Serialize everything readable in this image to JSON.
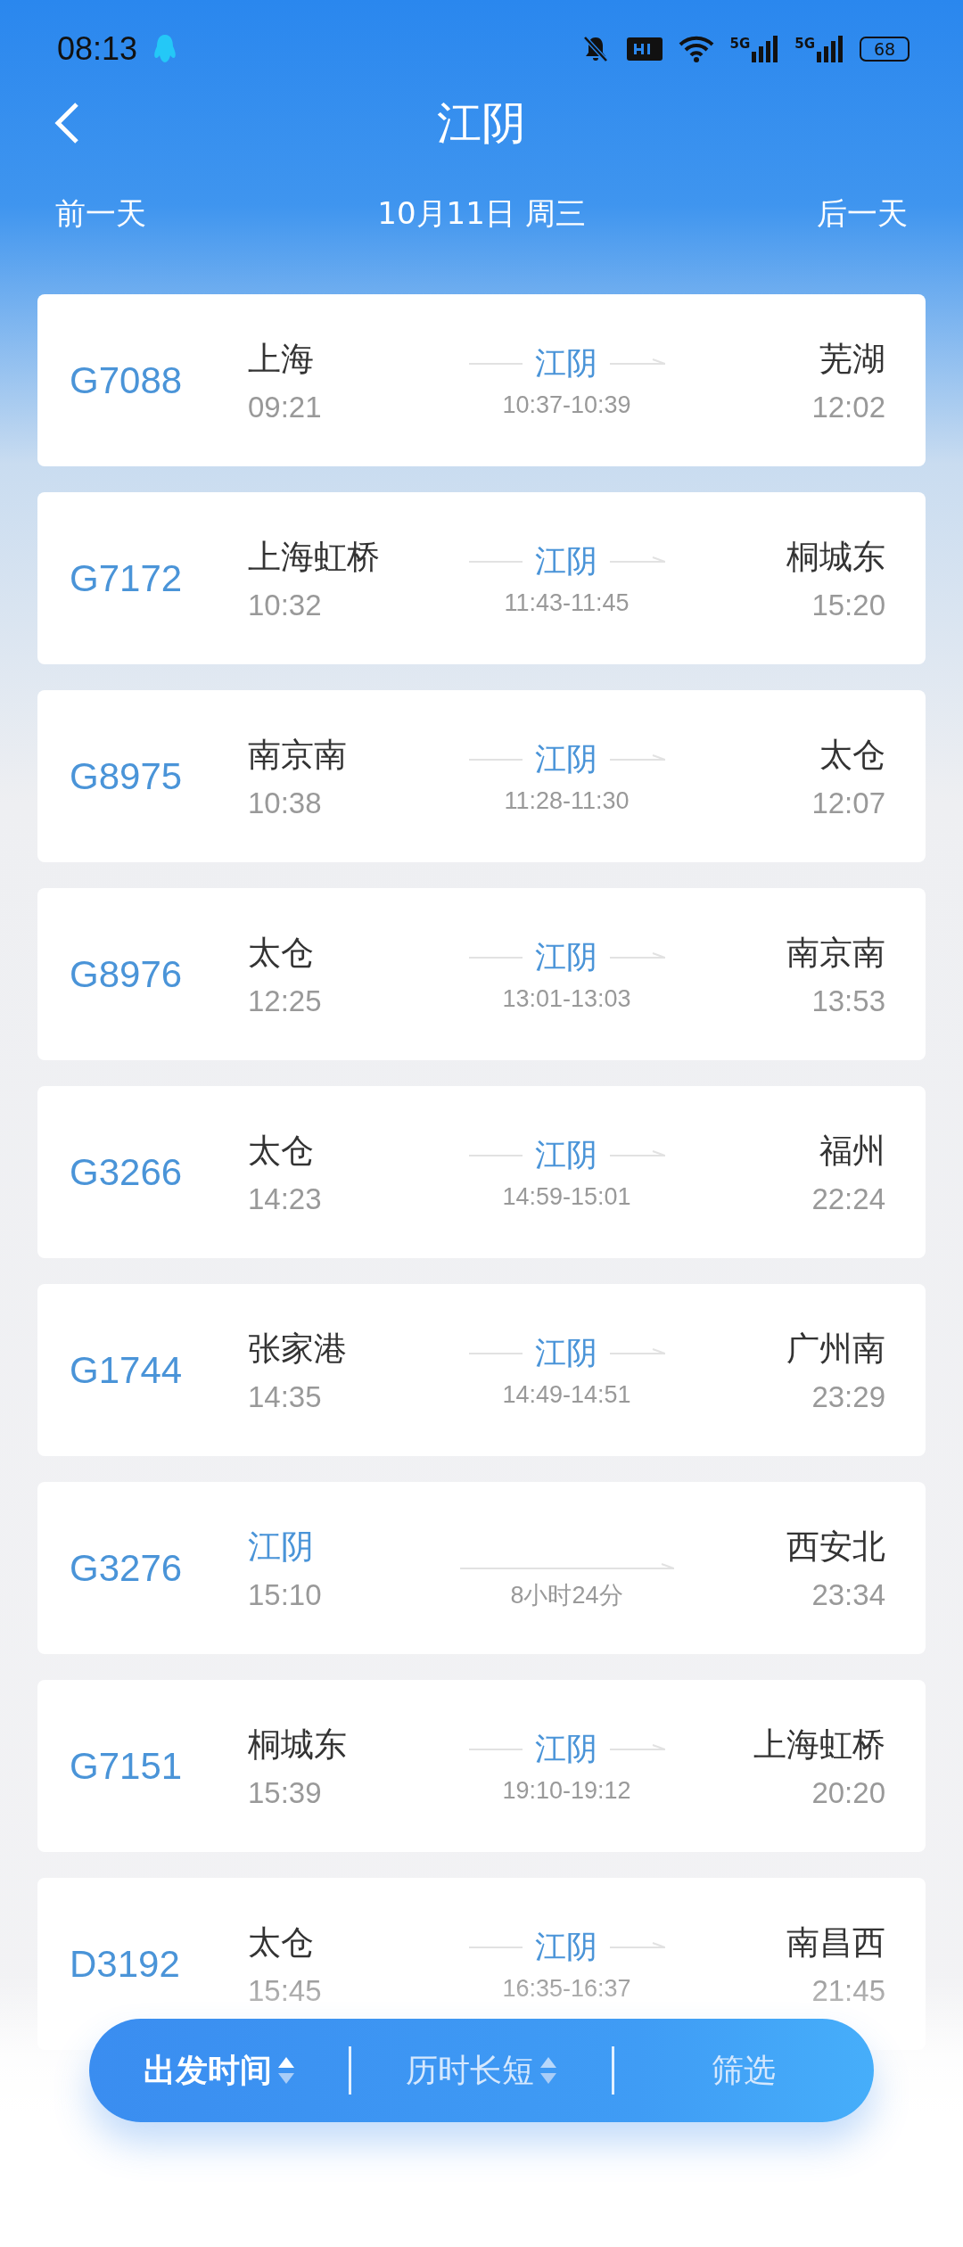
{
  "status_bar": {
    "time": "08:13",
    "network": [
      "5G",
      "5G"
    ],
    "battery": "68"
  },
  "header": {
    "title": "江阴",
    "prev": "前一天",
    "date": "10月11日 周三",
    "next": "后一天"
  },
  "trains": [
    {
      "kind": "via",
      "number": "G7088",
      "from": "上海",
      "depart": "09:21",
      "via": "江阴",
      "stop": "10:37-10:39",
      "to": "芜湖",
      "arrive": "12:02"
    },
    {
      "kind": "via",
      "number": "G7172",
      "from": "上海虹桥",
      "depart": "10:32",
      "via": "江阴",
      "stop": "11:43-11:45",
      "to": "桐城东",
      "arrive": "15:20"
    },
    {
      "kind": "via",
      "number": "G8975",
      "from": "南京南",
      "depart": "10:38",
      "via": "江阴",
      "stop": "11:28-11:30",
      "to": "太仓",
      "arrive": "12:07"
    },
    {
      "kind": "via",
      "number": "G8976",
      "from": "太仓",
      "depart": "12:25",
      "via": "江阴",
      "stop": "13:01-13:03",
      "to": "南京南",
      "arrive": "13:53"
    },
    {
      "kind": "via",
      "number": "G3266",
      "from": "太仓",
      "depart": "14:23",
      "via": "江阴",
      "stop": "14:59-15:01",
      "to": "福州",
      "arrive": "22:24"
    },
    {
      "kind": "via",
      "number": "G1744",
      "from": "张家港",
      "depart": "14:35",
      "via": "江阴",
      "stop": "14:49-14:51",
      "to": "广州南",
      "arrive": "23:29"
    },
    {
      "kind": "start",
      "number": "G3276",
      "from": "江阴",
      "depart": "15:10",
      "duration": "8小时24分",
      "to": "西安北",
      "arrive": "23:34"
    },
    {
      "kind": "via",
      "number": "G7151",
      "from": "桐城东",
      "depart": "15:39",
      "via": "江阴",
      "stop": "19:10-19:12",
      "to": "上海虹桥",
      "arrive": "20:20"
    },
    {
      "kind": "via",
      "number": "D3192",
      "from": "太仓",
      "depart": "15:45",
      "via": "江阴",
      "stop": "16:35-16:37",
      "to": "南昌西",
      "arrive": "21:45"
    }
  ],
  "sort_bar": [
    {
      "kind": "sort",
      "label": "出发时间",
      "selected": true
    },
    {
      "kind": "sort",
      "label": "历时长短",
      "selected": false
    },
    {
      "kind": "filter",
      "label": "筛选",
      "selected": false
    }
  ]
}
